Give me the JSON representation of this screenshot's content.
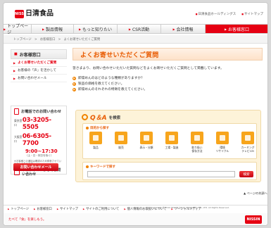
{
  "brand": {
    "badge": "NISSIN",
    "name": "日清食品"
  },
  "toplinks": [
    "日清食品ホールディングス",
    "サイトマップ"
  ],
  "nav": [
    {
      "label": "トップページ",
      "w": 40
    },
    {
      "label": "製品情報",
      "w": 60
    },
    {
      "label": "もっと知りたい",
      "w": 62
    },
    {
      "label": "CSR活動",
      "w": 62
    },
    {
      "label": "会社情報",
      "w": 63
    },
    {
      "label": "お客様窓口",
      "w": 90
    }
  ],
  "breadcrumb": "トップページ　>　お客様窓口　>　よくお寄せいただくご質問",
  "side": {
    "title": "お客様窓口",
    "links": [
      "よくお寄せいただくご質問",
      "お客様の「声」を活かして",
      "お問い合わせメール"
    ]
  },
  "phone": {
    "title": "お電話でのお問い合わせ",
    "tokyo_label": "東京窓口",
    "tokyo": "03-3205-5505",
    "osaka_label": "大阪窓口",
    "osaka": "06-6305-7700",
    "hours": "9:00~17:30",
    "hours_sub": "（土・日・祝日を除く）",
    "note": "※お客様との通話は確認のため録音させていただいております。",
    "web": "ウェブサイトからのお問い合わせ",
    "mail_btn": "お問い合わせメール"
  },
  "main": {
    "title": "よくお寄せいただくご質問",
    "intro": "皆さまより、お問い合わせいただいた質問などをよくお寄せいただくご質問として掲載しています。",
    "questions": [
      "即席めんのはどのような種類がありますか？",
      "製品の価格を教えてください。",
      "即席めんのそれぞれの特徴を教えてください。"
    ]
  },
  "qa": {
    "logo": "Q＆A",
    "suffix": "を検索",
    "category_label": "目的から探す",
    "categories": [
      "製品",
      "販売",
      "表示・分類",
      "工場・製造",
      "取り扱い\n保存方法",
      "環境\nリサイクル",
      "カーミング\nテレビCM"
    ],
    "keyword_label": "キーワードで探す",
    "search_btn": "検索"
  },
  "totop": "▲ ページの先頭へ",
  "footer": {
    "links": [
      "トップページ",
      "お客様窓口",
      "サイトマップ",
      "サイトのご利用について",
      "個人情報のお取扱いについて",
      "ソーシャルメディア"
    ],
    "copyright": "Copyright © 2010 NISSIN FOOD PRODUCTS CO., LTD. All Rights Reserved.",
    "slogan": "たべて「食」を楽しもう。",
    "logo": "NISSIN"
  }
}
